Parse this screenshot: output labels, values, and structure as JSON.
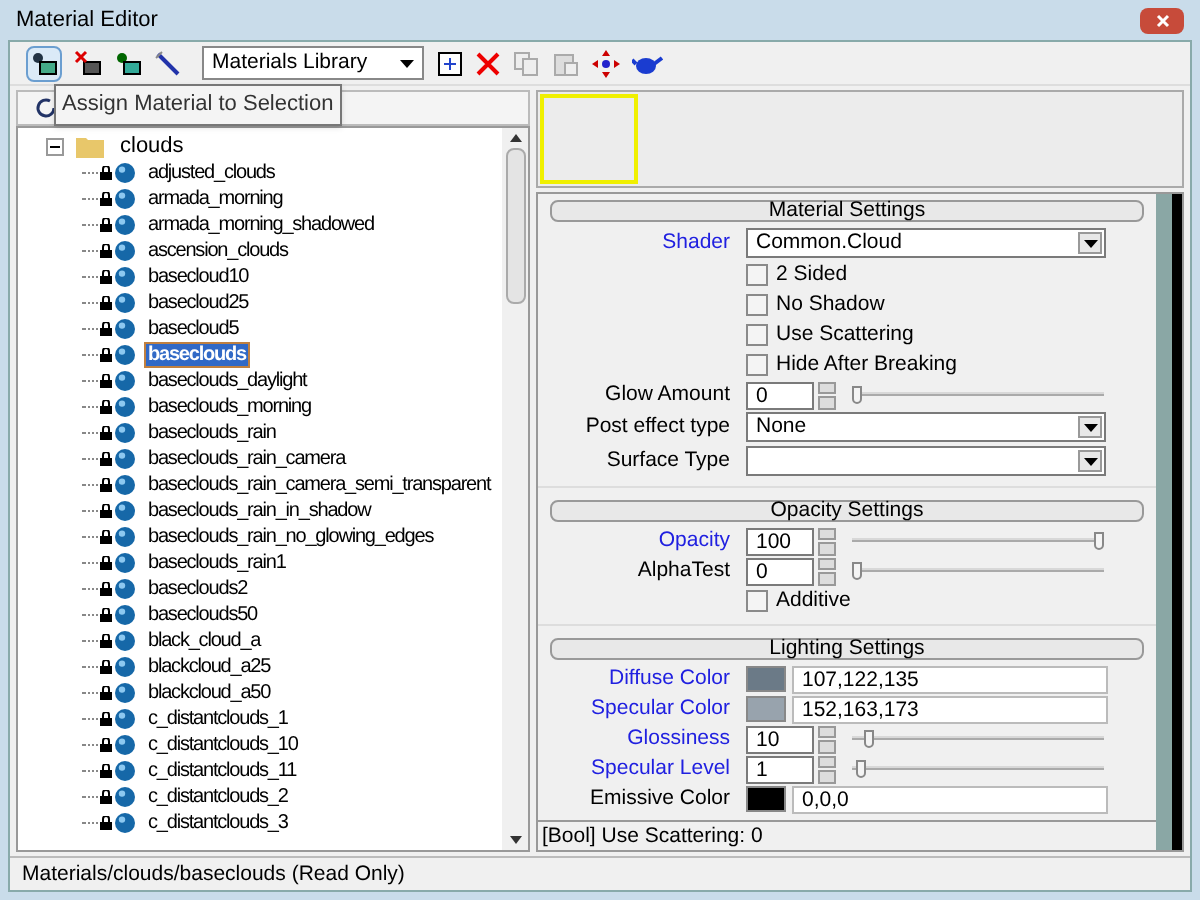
{
  "window": {
    "title": "Material Editor"
  },
  "toolbar": {
    "library": "Materials Library",
    "tooltip": "Assign Material to Selection"
  },
  "tree": {
    "folder": {
      "label": "clouds",
      "expanded": true,
      "children": [
        {
          "label": "adjusted_clouds",
          "selected": false
        },
        {
          "label": "armada_morning",
          "selected": false
        },
        {
          "label": "armada_morning_shadowed",
          "selected": false
        },
        {
          "label": "ascension_clouds",
          "selected": false
        },
        {
          "label": "basecloud10",
          "selected": false
        },
        {
          "label": "basecloud25",
          "selected": false
        },
        {
          "label": "basecloud5",
          "selected": false
        },
        {
          "label": "baseclouds",
          "selected": true
        },
        {
          "label": "baseclouds_daylight",
          "selected": false
        },
        {
          "label": "baseclouds_morning",
          "selected": false
        },
        {
          "label": "baseclouds_rain",
          "selected": false
        },
        {
          "label": "baseclouds_rain_camera",
          "selected": false
        },
        {
          "label": "baseclouds_rain_camera_semi_transparent",
          "selected": false
        },
        {
          "label": "baseclouds_rain_in_shadow",
          "selected": false
        },
        {
          "label": "baseclouds_rain_no_glowing_edges",
          "selected": false
        },
        {
          "label": "baseclouds_rain1",
          "selected": false
        },
        {
          "label": "baseclouds2",
          "selected": false
        },
        {
          "label": "baseclouds50",
          "selected": false
        },
        {
          "label": "black_cloud_a",
          "selected": false
        },
        {
          "label": "blackcloud_a25",
          "selected": false
        },
        {
          "label": "blackcloud_a50",
          "selected": false
        },
        {
          "label": "c_distantclouds_1",
          "selected": false
        },
        {
          "label": "c_distantclouds_10",
          "selected": false
        },
        {
          "label": "c_distantclouds_11",
          "selected": false
        },
        {
          "label": "c_distantclouds_2",
          "selected": false
        },
        {
          "label": "c_distantclouds_3",
          "selected": false
        }
      ]
    }
  },
  "sections": [
    {
      "title": "Material Settings",
      "rows": [
        {
          "kind": "dropdown",
          "label": "Shader",
          "modified": true,
          "value": "Common.Cloud"
        },
        {
          "kind": "checkbox",
          "label": "2 Sided",
          "checked": false
        },
        {
          "kind": "checkbox",
          "label": "No Shadow",
          "checked": false
        },
        {
          "kind": "checkbox",
          "label": "Use Scattering",
          "checked": false
        },
        {
          "kind": "checkbox",
          "label": "Hide After Breaking",
          "checked": false
        },
        {
          "kind": "spinner",
          "label": "Glow Amount",
          "modified": false,
          "value": "0",
          "level": 0
        },
        {
          "kind": "dropdown",
          "label": "Post effect type",
          "modified": false,
          "value": "None"
        },
        {
          "kind": "dropdown",
          "label": "Surface Type",
          "modified": false
        }
      ]
    },
    {
      "title": "Opacity Settings",
      "rows": [
        {
          "kind": "spinner",
          "label": "Opacity",
          "modified": true,
          "value": "100",
          "level": 1
        },
        {
          "kind": "spinner",
          "label": "AlphaTest",
          "modified": false,
          "value": "0",
          "level": 0
        },
        {
          "kind": "checkbox",
          "label": "Additive",
          "checked": false
        }
      ]
    },
    {
      "title": "Lighting Settings",
      "rows": [
        {
          "kind": "color",
          "label": "Diffuse Color",
          "modified": true,
          "value": "107,122,135",
          "color": "#6b7a87"
        },
        {
          "kind": "color",
          "label": "Specular Color",
          "modified": true,
          "value": "152,163,173",
          "color": "#98a3ad"
        },
        {
          "kind": "spinner",
          "label": "Glossiness",
          "modified": true,
          "value": "10",
          "level": 0.05
        },
        {
          "kind": "spinner",
          "label": "Specular Level",
          "modified": true,
          "value": "1",
          "level": 0.02
        },
        {
          "kind": "color",
          "label": "Emissive Color",
          "modified": false,
          "value": "0,0,0",
          "color": "#000000"
        }
      ]
    }
  ],
  "property_status": "[Bool] Use Scattering: 0",
  "status_bar": "Materials/clouds/baseclouds (Read Only)"
}
